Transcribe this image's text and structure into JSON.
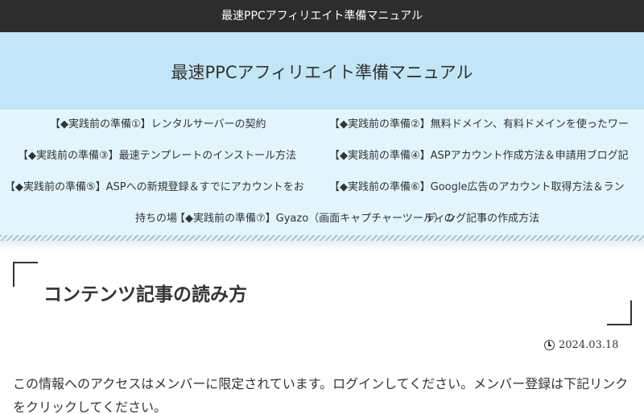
{
  "topbar": {
    "title": "最速PPCアフィリエイト準備マニュアル"
  },
  "header": {
    "site_title": "最速PPCアフィリエイト準備マニュアル"
  },
  "nav": {
    "items": [
      "【◆実践前の準備①】レンタルサーバーの契約",
      "【◆実践前の準備②】無料ドメイン、有料ドメインを使ったワー",
      "【◆実践前の準備③】最速テンプレートのインストール方法",
      "【◆実践前の準備④】ASPアカウント作成方法＆申請用ブログ記",
      "【◆実践前の準備⑤】ASPへの新規登録＆すでにアカウントをお",
      "【◆実践前の準備⑥】Google広告のアカウント取得方法＆ラン",
      "【◆実践前の準備⑦】Gyazo（画面キャプチャーツール）の",
      "持ちの場",
      "ディング記事の作成方法"
    ]
  },
  "article": {
    "title": "コンテンツ記事の読み方",
    "date": "2024.03.18",
    "body": "この情報へのアクセスはメンバーに限定されています。ログインしてください。メンバー登録は下記リンクをクリックしてください。"
  },
  "icons": {
    "date": "clock-icon"
  }
}
